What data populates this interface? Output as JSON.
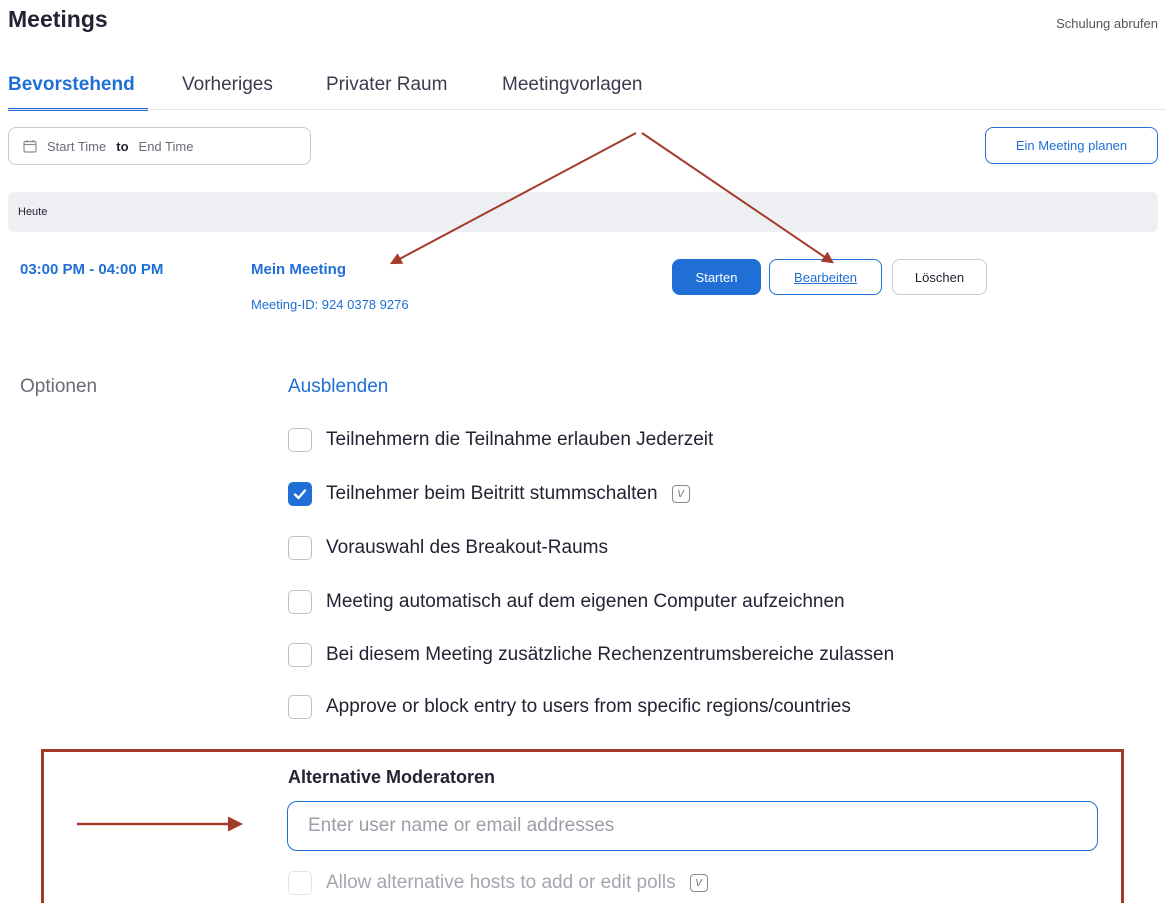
{
  "header": {
    "title": "Meetings",
    "training_link": "Schulung abrufen"
  },
  "tabs": [
    {
      "label": "Bevorstehend",
      "active": true
    },
    {
      "label": "Vorheriges",
      "active": false
    },
    {
      "label": "Privater Raum",
      "active": false
    },
    {
      "label": "Meetingvorlagen",
      "active": false
    }
  ],
  "filter": {
    "start_placeholder": "Start Time",
    "separator": "to",
    "end_placeholder": "End Time",
    "icon": "calendar-icon"
  },
  "schedule_button": "Ein Meeting planen",
  "day_header": "Heute",
  "meeting": {
    "time": "03:00 PM - 04:00 PM",
    "name": "Mein Meeting",
    "id_text": "Meeting-ID: 924 0378 9276",
    "start_label": "Starten",
    "edit_label": "Bearbeiten",
    "delete_label": "Löschen"
  },
  "options": {
    "label": "Optionen",
    "hide_link": "Ausblenden",
    "items": [
      {
        "label": "Teilnehmern die Teilnahme erlauben Jederzeit",
        "checked": false
      },
      {
        "label": "Teilnehmer beim Beitritt stummschalten",
        "checked": true
      },
      {
        "label": "Vorauswahl des Breakout-Raums",
        "checked": false
      },
      {
        "label": "Meeting automatisch auf dem eigenen Computer aufzeichnen",
        "checked": false
      },
      {
        "label": "Bei diesem Meeting zusätzliche Rechenzentrumsbereiche zulassen",
        "checked": false
      },
      {
        "label": "Approve or block entry to users from specific regions/countries",
        "checked": false
      }
    ]
  },
  "alternative_hosts": {
    "title": "Alternative Moderatoren",
    "input_placeholder": "Enter user name or email addresses",
    "polls_label": "Allow alternative hosts to add or edit polls"
  },
  "colors": {
    "accent": "#1f6fd6",
    "annotation": "#a33a2a"
  }
}
